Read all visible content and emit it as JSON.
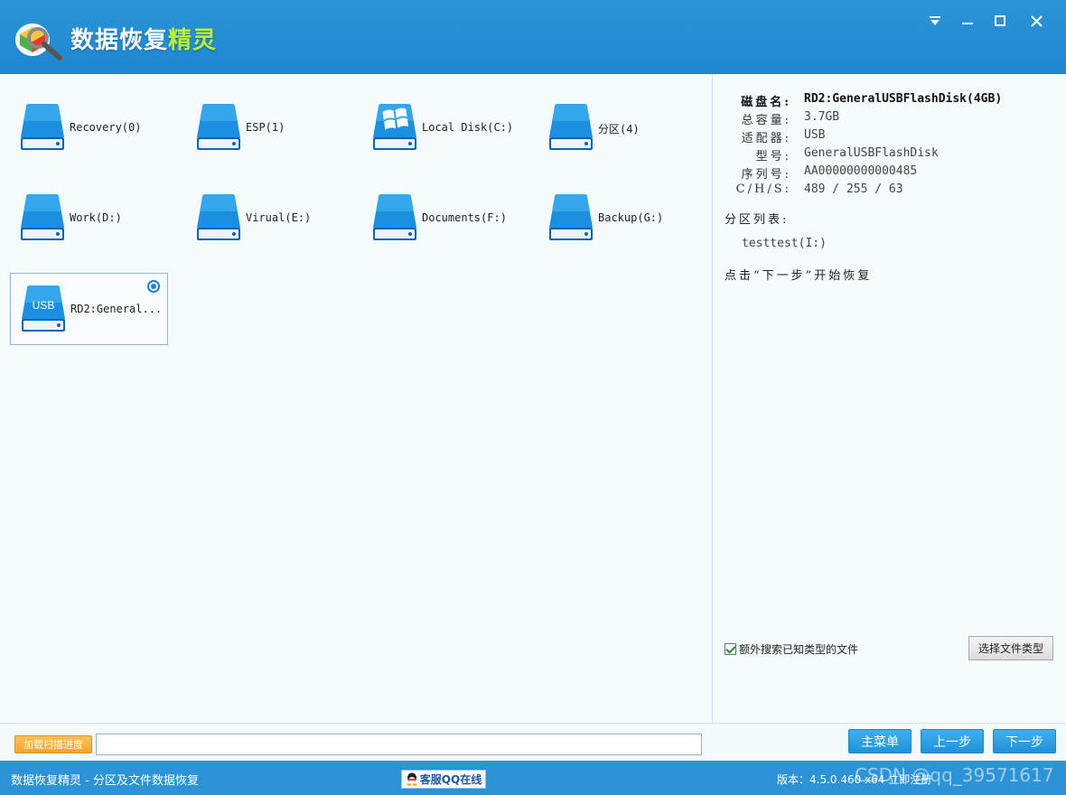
{
  "app": {
    "title_main": "数据恢复",
    "title_accent": "精灵"
  },
  "drives": [
    {
      "label": "Recovery(0)",
      "icon": "hdd-icon"
    },
    {
      "label": "ESP(1)",
      "icon": "hdd-icon"
    },
    {
      "label": "Local Disk(C:)",
      "icon": "windows-disk-icon"
    },
    {
      "label": "分区(4)",
      "icon": "hdd-icon"
    },
    {
      "label": "Work(D:)",
      "icon": "hdd-icon"
    },
    {
      "label": "Virual(E:)",
      "icon": "hdd-icon"
    },
    {
      "label": "Documents(F:)",
      "icon": "hdd-icon"
    },
    {
      "label": "Backup(G:)",
      "icon": "hdd-icon"
    },
    {
      "label": "RD2:General...",
      "icon": "usb-disk-icon",
      "badge": "USB",
      "selected": true
    }
  ],
  "disk_info": {
    "rows": [
      {
        "key": "磁盘名:",
        "value": "RD2:GeneralUSBFlashDisk(4GB)",
        "bold": true
      },
      {
        "key": "总容量:",
        "value": "3.7GB"
      },
      {
        "key": "适配器:",
        "value": "USB"
      },
      {
        "key": "型号:",
        "value": "GeneralUSBFlashDisk"
      },
      {
        "key": "序列号:",
        "value": "AA00000000000485"
      },
      {
        "key": "C/H/S:",
        "value": "489 / 255 / 63"
      }
    ],
    "partition_list_label": "分区列表:",
    "partitions": [
      "testtest(I:)"
    ],
    "hint": "点击“下一步”开始恢复"
  },
  "options": {
    "extra_search_label": "额外搜索已知类型的文件",
    "extra_search_checked": true,
    "select_type_button": "选择文件类型"
  },
  "bottom": {
    "load_button": "加载扫描进度",
    "main_menu_button": "主菜单",
    "prev_button": "上一步",
    "next_button": "下一步"
  },
  "status": {
    "left_text": "数据恢复精灵 - 分区及文件数据恢复",
    "qq_button": "客服QQ在线",
    "version_text": "版本：4.5.0.460 x64  立即注册",
    "watermark": "CSDN @qq_39571617"
  },
  "colors": {
    "brand_blue": "#2b93d6",
    "accent_green": "#b6f23a",
    "button_blue": "#2a9ee4",
    "load_orange": "#f3a32a"
  }
}
